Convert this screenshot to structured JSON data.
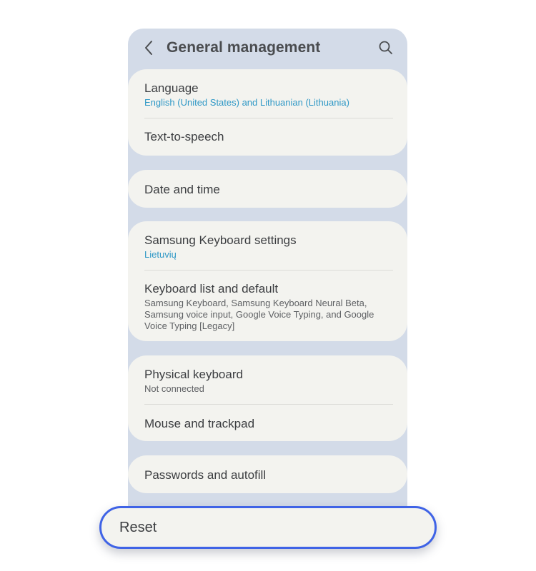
{
  "header": {
    "title": "General management",
    "back_icon": "chevron-left-icon",
    "search_icon": "search-icon"
  },
  "groups": [
    {
      "items": [
        {
          "title": "Language",
          "subtitle": "English (United States) and Lithuanian (Lithuania)"
        },
        {
          "title": "Text-to-speech"
        }
      ]
    },
    {
      "items": [
        {
          "title": "Date and time"
        }
      ]
    },
    {
      "items": [
        {
          "title": "Samsung Keyboard settings",
          "subtitle": "Lietuvių"
        },
        {
          "title": "Keyboard list and default",
          "subtitle": "Samsung Keyboard, Samsung Keyboard Neural Beta, Samsung voice input, Google Voice Typing, and Google Voice Typing [Legacy]"
        }
      ]
    },
    {
      "items": [
        {
          "title": "Physical keyboard",
          "subtitle": "Not connected"
        },
        {
          "title": "Mouse and trackpad"
        }
      ]
    },
    {
      "items": [
        {
          "title": "Passwords and autofill"
        }
      ]
    }
  ],
  "reset": {
    "label": "Reset"
  },
  "colors": {
    "accent": "#2f98c6",
    "highlight_border": "#3f63e6",
    "panel_background": "#d3dbe8",
    "card_background": "#f3f3ef"
  }
}
